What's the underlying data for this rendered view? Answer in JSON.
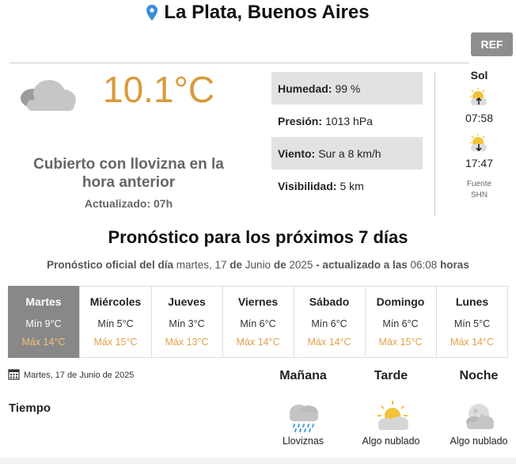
{
  "location": {
    "title": "La Plata, Buenos Aires"
  },
  "ref_button": "REF",
  "current": {
    "temperature": "10.1°C",
    "description": "Cubierto con llovizna en la hora anterior",
    "updated": "Actualizado: 07h",
    "stats": [
      {
        "label": "Humedad:",
        "value": "99 %"
      },
      {
        "label": "Presión:",
        "value": "1013 hPa"
      },
      {
        "label": "Viento:",
        "value": "Sur a 8 km/h"
      },
      {
        "label": "Visibilidad:",
        "value": "5 km"
      }
    ],
    "sun": {
      "title": "Sol",
      "sunrise": "07:58",
      "sunset": "17:47",
      "source_label": "Fuente",
      "source": "SHN"
    }
  },
  "forecast": {
    "title": "Pronóstico para los próximos 7 días",
    "subtitle_prefix": "Pronóstico oficial del día",
    "subtitle_date_a": "martes, 17",
    "subtitle_de1": "de",
    "subtitle_date_b": "Junio",
    "subtitle_de2": "de",
    "subtitle_year": "2025",
    "subtitle_updated": "- actualizado a las",
    "subtitle_time": "06:08",
    "subtitle_suffix": "horas",
    "days": [
      {
        "name": "Martes",
        "min": "Mín 9°C",
        "max": "Máx 14°C"
      },
      {
        "name": "Miércoles",
        "min": "Mín 5°C",
        "max": "Máx 15°C"
      },
      {
        "name": "Jueves",
        "min": "Mín 3°C",
        "max": "Máx 13°C"
      },
      {
        "name": "Viernes",
        "min": "Mín 6°C",
        "max": "Máx 14°C"
      },
      {
        "name": "Sábado",
        "min": "Mín 6°C",
        "max": "Máx 14°C"
      },
      {
        "name": "Domingo",
        "min": "Mín 6°C",
        "max": "Máx 15°C"
      },
      {
        "name": "Lunes",
        "min": "Mín 5°C",
        "max": "Máx 14°C"
      }
    ]
  },
  "detail": {
    "date": "Martes, 17 de Junio de 2025",
    "row_label": "Tiempo",
    "periods": [
      {
        "name": "Mañana",
        "weather": "Lloviznas",
        "icon": "drizzle-icon"
      },
      {
        "name": "Tarde",
        "weather": "Algo nublado",
        "icon": "partly-cloudy-day-icon"
      },
      {
        "name": "Noche",
        "weather": "Algo nublado",
        "icon": "partly-cloudy-night-icon"
      }
    ]
  },
  "colors": {
    "accent": "#d99a3b",
    "selected_day": "#888888",
    "stat_bg": "#e2e2e2"
  }
}
